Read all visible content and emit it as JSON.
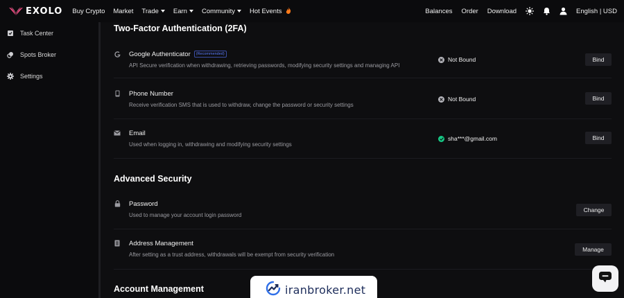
{
  "header": {
    "logo_text": "EXOLO",
    "nav": [
      {
        "label": "Buy Crypto",
        "caret": false
      },
      {
        "label": "Market",
        "caret": false
      },
      {
        "label": "Trade",
        "caret": true
      },
      {
        "label": "Earn",
        "caret": true
      },
      {
        "label": "Community",
        "caret": true
      },
      {
        "label": "Hot Events",
        "caret": false
      }
    ],
    "hot_icon": "fire-icon",
    "right": {
      "balances": "Balances",
      "order": "Order",
      "download": "Download",
      "theme_icon": "sun-icon",
      "notification_icon": "bell-icon",
      "user_icon": "user-icon",
      "locale": "English | USD"
    }
  },
  "sidebar": {
    "items": [
      {
        "label": "Task Center",
        "icon": "task-icon"
      },
      {
        "label": "Spots Broker",
        "icon": "broker-icon"
      },
      {
        "label": "Settings",
        "icon": "gear-icon"
      }
    ]
  },
  "sections": {
    "two_fa": {
      "title": "Two-Factor Authentication (2FA)",
      "google": {
        "title": "Google Authenticator",
        "badge": "(Recommended)",
        "desc": "API Secure verification when withdrawing, retrieving passwords, modifying security settings and managing API",
        "status": "Not Bound",
        "button": "Bind"
      },
      "phone": {
        "title": "Phone Number",
        "desc": "Receive verification SMS that is used to withdraw, change the password or security settings",
        "status": "Not Bound",
        "button": "Bind"
      },
      "email": {
        "title": "Email",
        "desc": "Used when logging in, withdrawing and modifying security settings",
        "status": "sha***@gmail.com",
        "button": "Bind"
      }
    },
    "advanced": {
      "title": "Advanced Security",
      "password": {
        "title": "Password",
        "desc": "Used to manage your account login password",
        "button": "Change"
      },
      "address": {
        "title": "Address Management",
        "desc": "After setting as a trust address, withdrawals will be exempt from security verification",
        "button": "Manage"
      }
    },
    "account": {
      "title": "Account Management"
    }
  },
  "watermark": {
    "text": "iranbroker.net"
  },
  "colors": {
    "brand": "#e8467c",
    "success": "#16c784",
    "background": "#0e0e10",
    "button": "#1f1f24"
  }
}
